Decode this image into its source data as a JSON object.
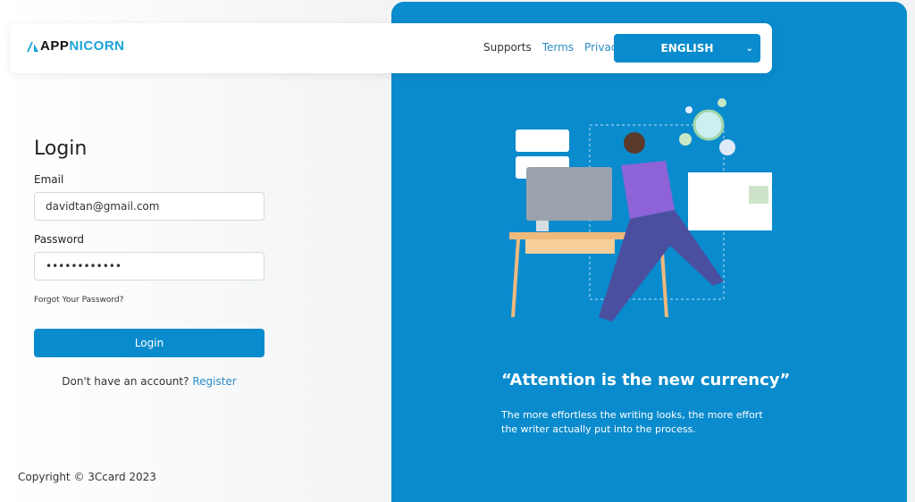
{
  "brand": {
    "part1": "APP",
    "part2": "NICORN"
  },
  "nav": {
    "links": [
      "Supports",
      "Terms",
      "Privacy"
    ],
    "language": "ENGLISH"
  },
  "login": {
    "title": "Login",
    "email_label": "Email",
    "email_value": "davidtan@gmail.com",
    "password_label": "Password",
    "password_value": "••••••••••••",
    "forgot": "Forgot Your Password?",
    "button": "Login",
    "no_account": "Don't have an account?",
    "register": "Register"
  },
  "footer": {
    "copyright": "Copyright © 3Ccard 2023"
  },
  "promo": {
    "quote": "“Attention is the new currency”",
    "text": "The more effortless the writing looks, the more effort the writer actually put into the process."
  },
  "colors": {
    "primary": "#0a8bcd",
    "link": "#2a8cc4"
  }
}
